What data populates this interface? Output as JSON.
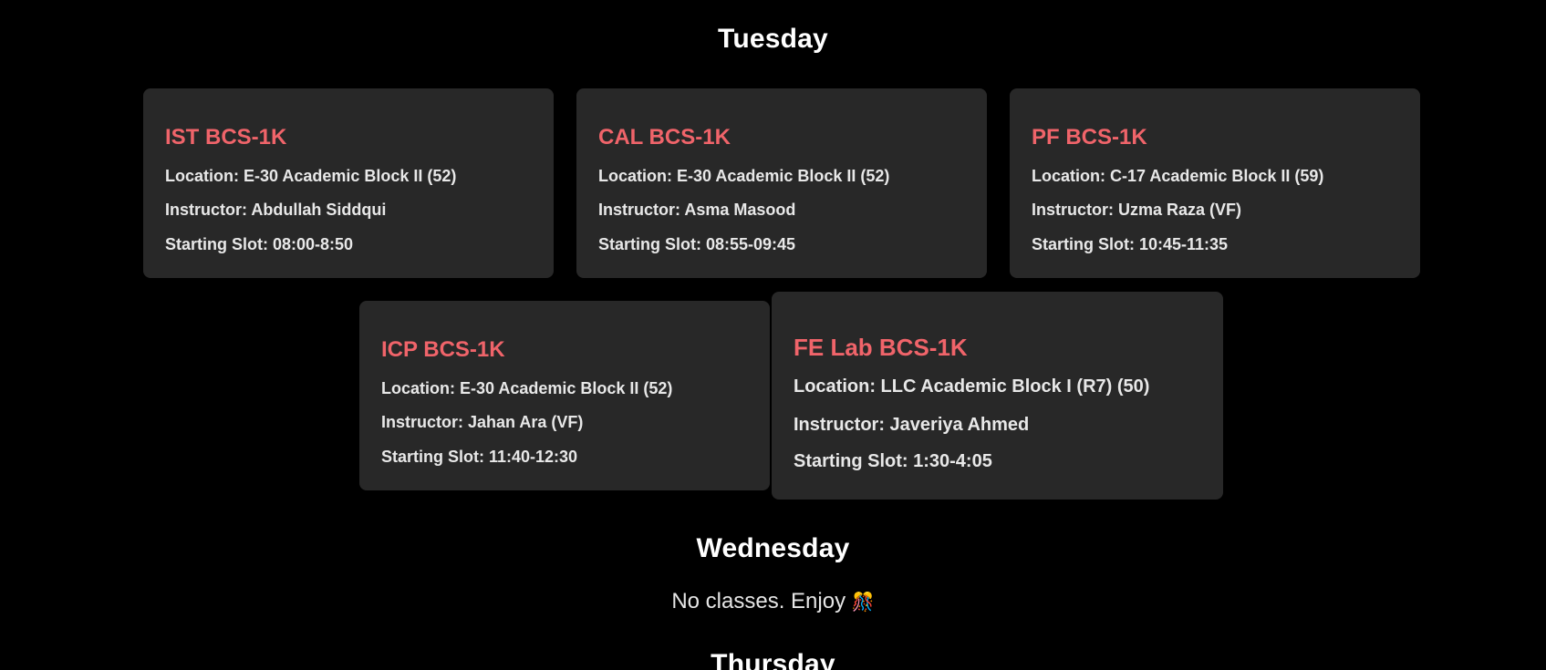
{
  "days": [
    {
      "name": "Tuesday",
      "classes": [
        {
          "course": "IST BCS-1K",
          "location": "Location: E-30 Academic Block II (52)",
          "instructor": "Instructor: Abdullah Siddqui",
          "slot": "Starting Slot: 08:00-8:50"
        },
        {
          "course": "CAL BCS-1K",
          "location": "Location: E-30 Academic Block II (52)",
          "instructor": "Instructor: Asma Masood",
          "slot": "Starting Slot: 08:55-09:45"
        },
        {
          "course": "PF BCS-1K",
          "location": "Location: C-17 Academic Block II (59)",
          "instructor": "Instructor: Uzma Raza (VF)",
          "slot": "Starting Slot: 10:45-11:35"
        },
        {
          "course": "ICP BCS-1K",
          "location": "Location: E-30 Academic Block II (52)",
          "instructor": "Instructor: Jahan Ara (VF)",
          "slot": "Starting Slot: 11:40-12:30"
        },
        {
          "course": "FE Lab BCS-1K",
          "location": "Location: LLC Academic Block I (R7) (50)",
          "instructor": "Instructor: Javeriya Ahmed",
          "slot": "Starting Slot: 1:30-4:05"
        }
      ]
    },
    {
      "name": "Wednesday",
      "empty_message": "No classes. Enjoy",
      "empty_icon": "party-icon"
    },
    {
      "name": "Thursday"
    }
  ],
  "colors": {
    "background": "#000000",
    "card": "#282828",
    "course_title": "#f0646a",
    "text": "#e8e8e8"
  }
}
